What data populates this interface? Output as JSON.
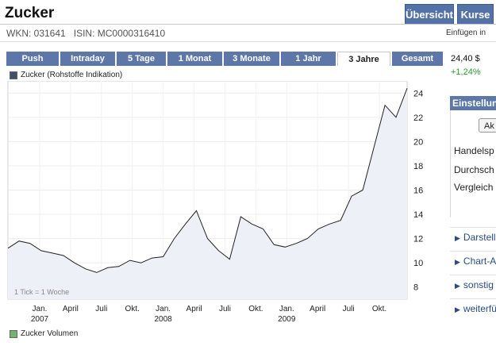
{
  "header": {
    "title": "Zucker",
    "overview_label": "Übersicht",
    "kurse_label": "Kurse",
    "wkn": "WKN: 031641",
    "isin": "ISIN: MC0000316410",
    "einfuegen": "Einfügen in"
  },
  "tabs": [
    "Push",
    "Intraday",
    "5 Tage",
    "1 Monat",
    "3 Monate",
    "1 Jahr",
    "3 Jahre",
    "Gesamt"
  ],
  "active_tab": "3 Jahre",
  "quote": {
    "price": "24,40 $",
    "change": "+1,24%"
  },
  "right_panel": {
    "header": "Einstellungen",
    "button": "Ak",
    "rows": [
      "Handelsp",
      "Durchsch",
      "Vergleich"
    ],
    "links": [
      "Darstell",
      "Chart-A",
      "sonstig",
      "weiterfü"
    ]
  },
  "chart_data": {
    "type": "line",
    "legend": "Zucker (Rohstoffe Indikation)",
    "footnote": "1 Tick = 1 Woche",
    "volume_legend": "Zucker Volumen",
    "x_tick_labels": [
      [
        "Jan.",
        "2007"
      ],
      [
        "April",
        ""
      ],
      [
        "Juli",
        ""
      ],
      [
        "Okt.",
        ""
      ],
      [
        "Jan.",
        "2008"
      ],
      [
        "April",
        ""
      ],
      [
        "Juli",
        ""
      ],
      [
        "Okt.",
        ""
      ],
      [
        "Jan.",
        "2009"
      ],
      [
        "April",
        ""
      ],
      [
        "Juli",
        ""
      ],
      [
        "Okt.",
        ""
      ]
    ],
    "y_ticks": [
      8,
      10,
      12,
      14,
      16,
      18,
      20,
      22,
      24
    ],
    "ylim": [
      7,
      25
    ],
    "colors": {
      "line": "#222222",
      "fill": "#eef0f8",
      "legend_swatch": "#44506a",
      "volume_swatch": "#6fb56f"
    },
    "x": [
      "2006-10",
      "2006-11",
      "2006-12",
      "2007-01",
      "2007-02",
      "2007-03",
      "2007-04",
      "2007-05",
      "2007-06",
      "2007-07",
      "2007-08",
      "2007-09",
      "2007-10",
      "2007-11",
      "2007-12",
      "2008-01",
      "2008-02",
      "2008-03",
      "2008-04",
      "2008-05",
      "2008-06",
      "2008-07",
      "2008-08",
      "2008-09",
      "2008-10",
      "2008-11",
      "2008-12",
      "2009-01",
      "2009-02",
      "2009-03",
      "2009-04",
      "2009-05",
      "2009-06",
      "2009-07",
      "2009-08",
      "2009-09",
      "2009-10"
    ],
    "y": [
      11.2,
      11.8,
      11.6,
      11.0,
      10.8,
      10.6,
      10.0,
      9.5,
      9.2,
      9.6,
      9.7,
      10.2,
      10.0,
      10.4,
      10.5,
      12.0,
      13.2,
      14.3,
      12.0,
      11.0,
      10.3,
      13.8,
      13.2,
      12.8,
      11.5,
      11.3,
      11.6,
      12.0,
      12.8,
      13.2,
      13.5,
      15.5,
      16.0,
      19.5,
      23.0,
      22.0,
      24.4
    ]
  }
}
